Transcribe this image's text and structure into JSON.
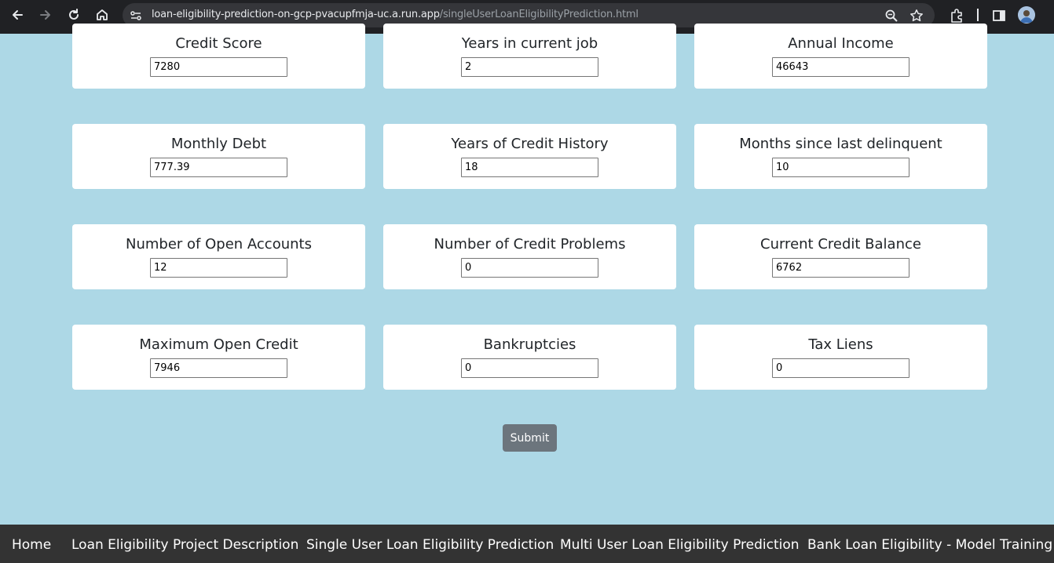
{
  "browser": {
    "url_domain": "loan-eligibility-prediction-on-gcp-pvacupfmja-uc.a.run.app",
    "url_path": "/singleUserLoanEligibilityPrediction.html"
  },
  "form": {
    "fields": [
      {
        "label": "Credit Score",
        "value": "7280"
      },
      {
        "label": "Years in current job",
        "value": "2"
      },
      {
        "label": "Annual Income",
        "value": "46643"
      },
      {
        "label": "Monthly Debt",
        "value": "777.39"
      },
      {
        "label": "Years of Credit History",
        "value": "18"
      },
      {
        "label": "Months since last delinquent",
        "value": "10"
      },
      {
        "label": "Number of Open Accounts",
        "value": "12"
      },
      {
        "label": "Number of Credit Problems",
        "value": "0"
      },
      {
        "label": "Current Credit Balance",
        "value": "6762"
      },
      {
        "label": "Maximum Open Credit",
        "value": "7946"
      },
      {
        "label": "Bankruptcies",
        "value": "0"
      },
      {
        "label": "Tax Liens",
        "value": "0"
      }
    ],
    "submit_label": "Submit"
  },
  "footer": {
    "links": [
      "Home",
      "Loan Eligibility Project Description",
      "Single User Loan Eligibility Prediction",
      "Multi User Loan Eligibility Prediction",
      "Bank Loan Eligibility - Model Training"
    ]
  }
}
